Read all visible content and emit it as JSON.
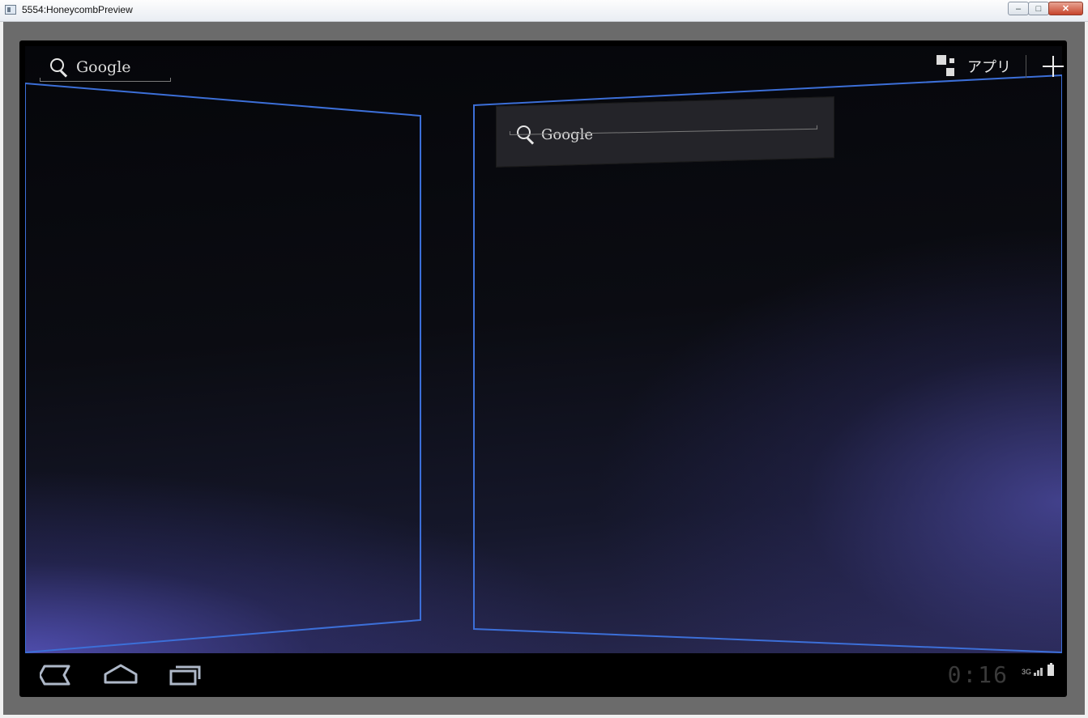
{
  "window": {
    "title": "5554:HoneycombPreview"
  },
  "home": {
    "search_widget_left": {
      "label": "Google"
    },
    "search_widget_card": {
      "label": "Google"
    },
    "apps_label": "アプリ"
  },
  "status_bar": {
    "time": "0:16",
    "network": "3G"
  },
  "colors": {
    "page_outline": "#3c6fd8",
    "accent": "#5a58c8"
  },
  "icons": [
    "search-icon",
    "apps-grid-icon",
    "add-icon",
    "back-icon",
    "home-icon",
    "recent-apps-icon",
    "signal-icon",
    "battery-icon"
  ]
}
